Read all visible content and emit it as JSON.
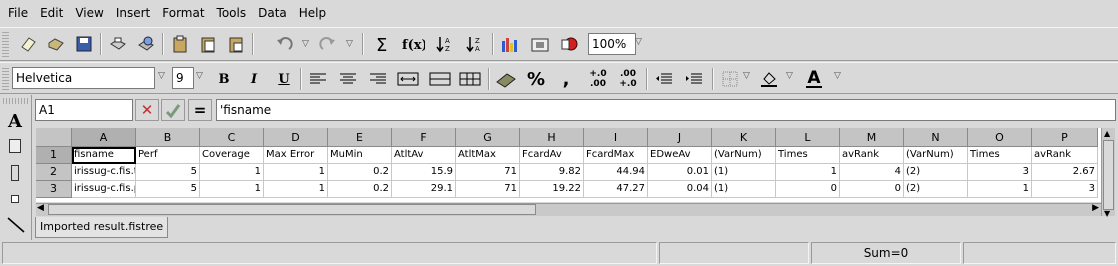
{
  "menu": [
    "File",
    "Edit",
    "View",
    "Insert",
    "Format",
    "Tools",
    "Data",
    "Help"
  ],
  "toolbar": {
    "zoom": "100%"
  },
  "format": {
    "font_name": "Helvetica",
    "font_size": "9",
    "bold": "B",
    "italic": "I",
    "underline": "U",
    "percent": "%",
    "thousands": ",",
    "inc_decimals_top": "+.0",
    "inc_decimals_bottom": ".00",
    "dec_decimals_top": ".00",
    "dec_decimals_bottom": "+.0",
    "font_color_letter": "A"
  },
  "formula": {
    "cell_ref": "A1",
    "cancel": "✕",
    "equals": "=",
    "content": "'fisname"
  },
  "palette": {
    "text_tool": "A"
  },
  "sheet": {
    "columns": [
      "A",
      "B",
      "C",
      "D",
      "E",
      "F",
      "G",
      "H",
      "I",
      "J",
      "K",
      "L",
      "M",
      "N",
      "O",
      "P"
    ],
    "rows": [
      "1",
      "2",
      "3"
    ],
    "cells": [
      [
        "fisname",
        "Perf",
        "Coverage",
        "Max Error",
        "MuMin",
        "AtltAv",
        "AtltMax",
        "FcardAv",
        "FcardMax",
        "EDweAv",
        "(VarNum)",
        "Times",
        "avRank",
        "(VarNum)",
        "Times",
        "avRank"
      ],
      [
        "irissug-c.fis.tre",
        "5",
        "1",
        "1",
        "0.2",
        "15.9",
        "71",
        "9.82",
        "44.94",
        "0.01",
        "(1)",
        "1",
        "4",
        "(2)",
        "3",
        "2.67"
      ],
      [
        "irissug-c.fis.pr",
        "5",
        "1",
        "1",
        "0.2",
        "29.1",
        "71",
        "19.22",
        "47.27",
        "0.04",
        "(1)",
        "0",
        "0",
        "(2)",
        "1",
        "3"
      ]
    ],
    "numeric_cols": [
      1,
      2,
      3,
      4,
      5,
      6,
      7,
      8,
      9,
      11,
      12,
      14,
      15
    ]
  },
  "tab": {
    "label": "Imported result.fistree"
  },
  "status": {
    "sum": "Sum=0"
  }
}
